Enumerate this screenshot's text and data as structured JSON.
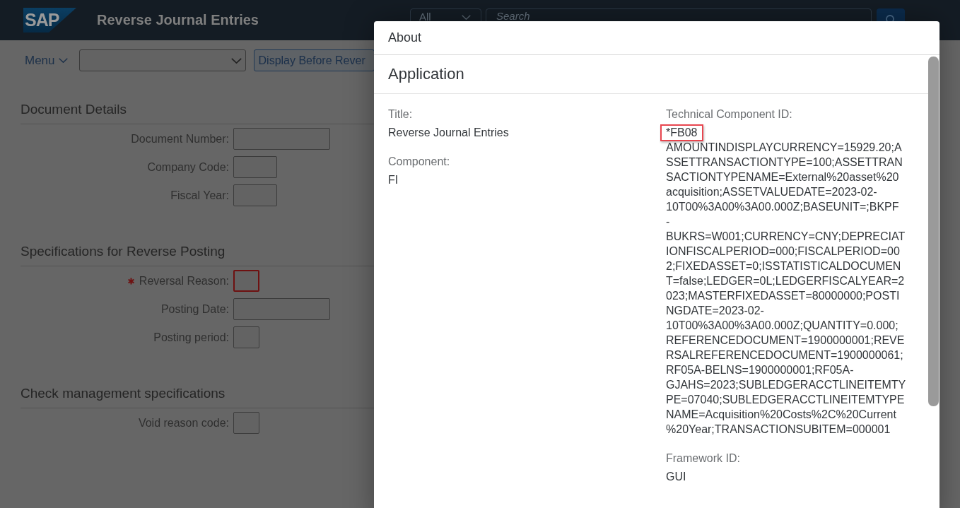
{
  "shell": {
    "logo": "SAP",
    "title": "Reverse Journal Entries",
    "search_scope": "All",
    "search": {
      "placeholder": "Search"
    }
  },
  "toolbar": {
    "menu": "Menu",
    "button": "Display Before Rever"
  },
  "sections": [
    {
      "title": "Document Details",
      "fields": [
        {
          "label": "Document Number:",
          "kind": "long",
          "required": false
        },
        {
          "label": "Company Code:",
          "kind": "medium",
          "required": false
        },
        {
          "label": "Fiscal Year:",
          "kind": "medium",
          "required": false
        }
      ]
    },
    {
      "title": "Specifications for Reverse Posting",
      "fields": [
        {
          "label": "Reversal Reason:",
          "kind": "short",
          "required": true
        },
        {
          "label": "Posting Date:",
          "kind": "long",
          "required": false
        },
        {
          "label": "Posting period:",
          "kind": "short",
          "required": false
        }
      ]
    },
    {
      "title": "Check management specifications",
      "fields": [
        {
          "label": "Void reason code:",
          "kind": "short",
          "required": false
        }
      ]
    }
  ],
  "about": {
    "title": "About",
    "section": "Application",
    "columns": [
      [
        {
          "label": "Title:",
          "value": "Reverse Journal Entries",
          "highlighted": false
        },
        {
          "label": "Component:",
          "value": "FI",
          "highlighted": false
        }
      ],
      [
        {
          "label": "Technical Component ID:",
          "value": "*FB08",
          "highlighted": true,
          "detail_lines": [
            "AMOUNTINDISPLAYCURRENCY=15929.20;A",
            "SSETTRANSACTIONTYPE=100;ASSETTRAN",
            "SACTIONTYPENAME=External%20asset%20",
            "acquisition;ASSETVALUEDATE=2023-02-",
            "10T00%3A00%3A00.000Z;BASEUNIT=;BKPF",
            "-",
            "BUKRS=W001;CURRENCY=CNY;DEPRECIAT",
            "IONFISCALPERIOD=000;FISCALPERIOD=00",
            "2;FIXEDASSET=0;ISSTATISTICALDOCUMEN",
            "T=false;LEDGER=0L;LEDGERFISCALYEAR=2",
            "023;MASTERFIXEDASSET=80000000;POSTI",
            "NGDATE=2023-02-",
            "10T00%3A00%3A00.000Z;QUANTITY=0.000;",
            "REFERENCEDOCUMENT=1900000001;REVE",
            "RSALREFERENCEDOCUMENT=1900000061;",
            "RF05A-BELNS=1900000001;RF05A-",
            "GJAHS=2023;SUBLEDGERACCTLINEITEMTY",
            "PE=07040;SUBLEDGERACCTLINEITEMTYPE",
            "NAME=Acquisition%20Costs%2C%20Current",
            "%20Year;TRANSACTIONSUBITEM=000001"
          ]
        },
        {
          "label": "Framework ID:",
          "value": "GUI",
          "highlighted": false
        }
      ]
    ]
  }
}
